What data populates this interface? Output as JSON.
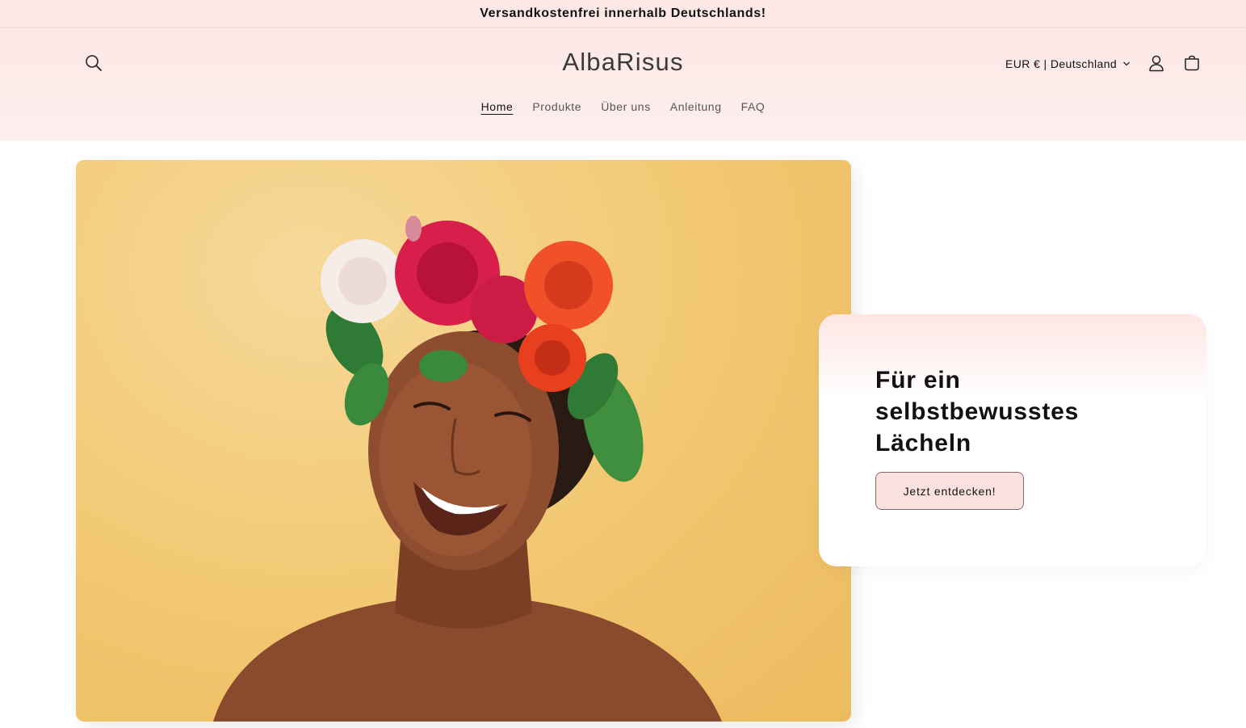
{
  "announcement": {
    "text": "Versandkostenfrei innerhalb Deutschlands!"
  },
  "header": {
    "logo": "AlbaRisus",
    "locale": "EUR € | Deutschland",
    "icons": {
      "search": "search-icon",
      "account": "account-icon",
      "cart": "cart-icon",
      "dropdown": "chevron-down-icon"
    }
  },
  "nav": {
    "items": [
      {
        "label": "Home",
        "active": true
      },
      {
        "label": "Produkte",
        "active": false
      },
      {
        "label": "Über uns",
        "active": false
      },
      {
        "label": "Anleitung",
        "active": false
      },
      {
        "label": "FAQ",
        "active": false
      }
    ]
  },
  "hero": {
    "heading": "Für ein selbstbewusstes Lächeln",
    "button": "Jetzt entdecken!"
  },
  "colors": {
    "header_bg": "#fde8e6",
    "button_bg": "#fde1df",
    "hero_bg": "#f2c770"
  }
}
